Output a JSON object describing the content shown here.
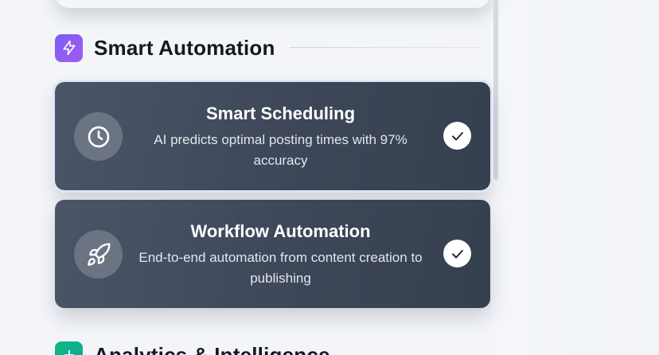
{
  "sections": [
    {
      "title": "Smart Automation",
      "icon": "lightning-icon",
      "color": "#8b5cf6"
    },
    {
      "title": "Analytics & Intelligence",
      "icon": "plus-icon",
      "color": "#10b981"
    }
  ],
  "cards": [
    {
      "title": "Smart Scheduling",
      "description": "AI predicts optimal posting times with 97% accuracy",
      "icon": "clock-icon",
      "selected": true
    },
    {
      "title": "Workflow Automation",
      "description": "End-to-end automation from content creation to publishing",
      "icon": "rocket-icon",
      "selected": true
    }
  ]
}
